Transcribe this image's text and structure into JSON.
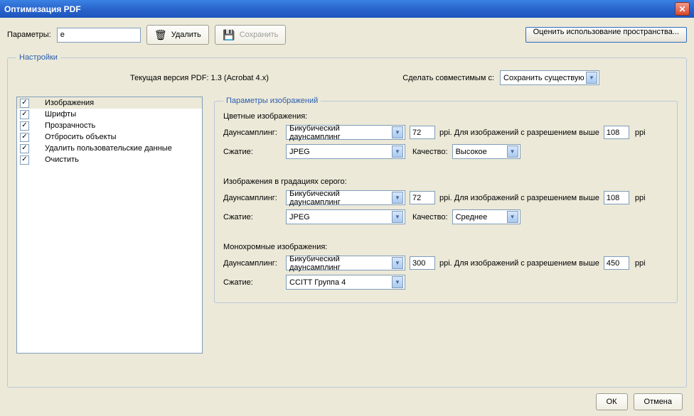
{
  "window_title": "Оптимизация PDF",
  "top": {
    "params_label": "Параметры:",
    "preset_value": "e",
    "delete_label": "Удалить",
    "save_label": "Сохранить",
    "audit_label": "Оценить использование пространства..."
  },
  "settings_legend": "Настройки",
  "version": {
    "current_label": "Текущая версия PDF: 1.3 (Acrobat 4.x)",
    "compat_label": "Сделать совместимым с:",
    "compat_value": "Сохранить существующую"
  },
  "categories": [
    {
      "checked": true,
      "label": "Изображения",
      "selected": true
    },
    {
      "checked": true,
      "label": "Шрифты"
    },
    {
      "checked": true,
      "label": "Прозрачность"
    },
    {
      "checked": true,
      "label": "Отбросить объекты"
    },
    {
      "checked": true,
      "label": "Удалить пользовательские данные"
    },
    {
      "checked": true,
      "label": "Очистить"
    }
  ],
  "imgparams_legend": "Параметры изображений",
  "labels": {
    "downsampling": "Даунсамплинг:",
    "compression": "Сжатие:",
    "quality": "Качество:",
    "ppi": "ppi",
    "above": "ppi. Для изображений с разрешением выше"
  },
  "color": {
    "title": "Цветные изображения:",
    "downsample": "Бикубический даунсамплинг",
    "target": "72",
    "above": "108",
    "compression": "JPEG",
    "quality": "Высокое"
  },
  "gray": {
    "title": "Изображения в градациях серого:",
    "downsample": "Бикубический даунсамплинг",
    "target": "72",
    "above": "108",
    "compression": "JPEG",
    "quality": "Среднее"
  },
  "mono": {
    "title": "Монохромные изображения:",
    "downsample": "Бикубический даунсамплинг",
    "target": "300",
    "above": "450",
    "compression": "CCITT Группа 4"
  },
  "buttons": {
    "ok": "ОК",
    "cancel": "Отмена"
  }
}
